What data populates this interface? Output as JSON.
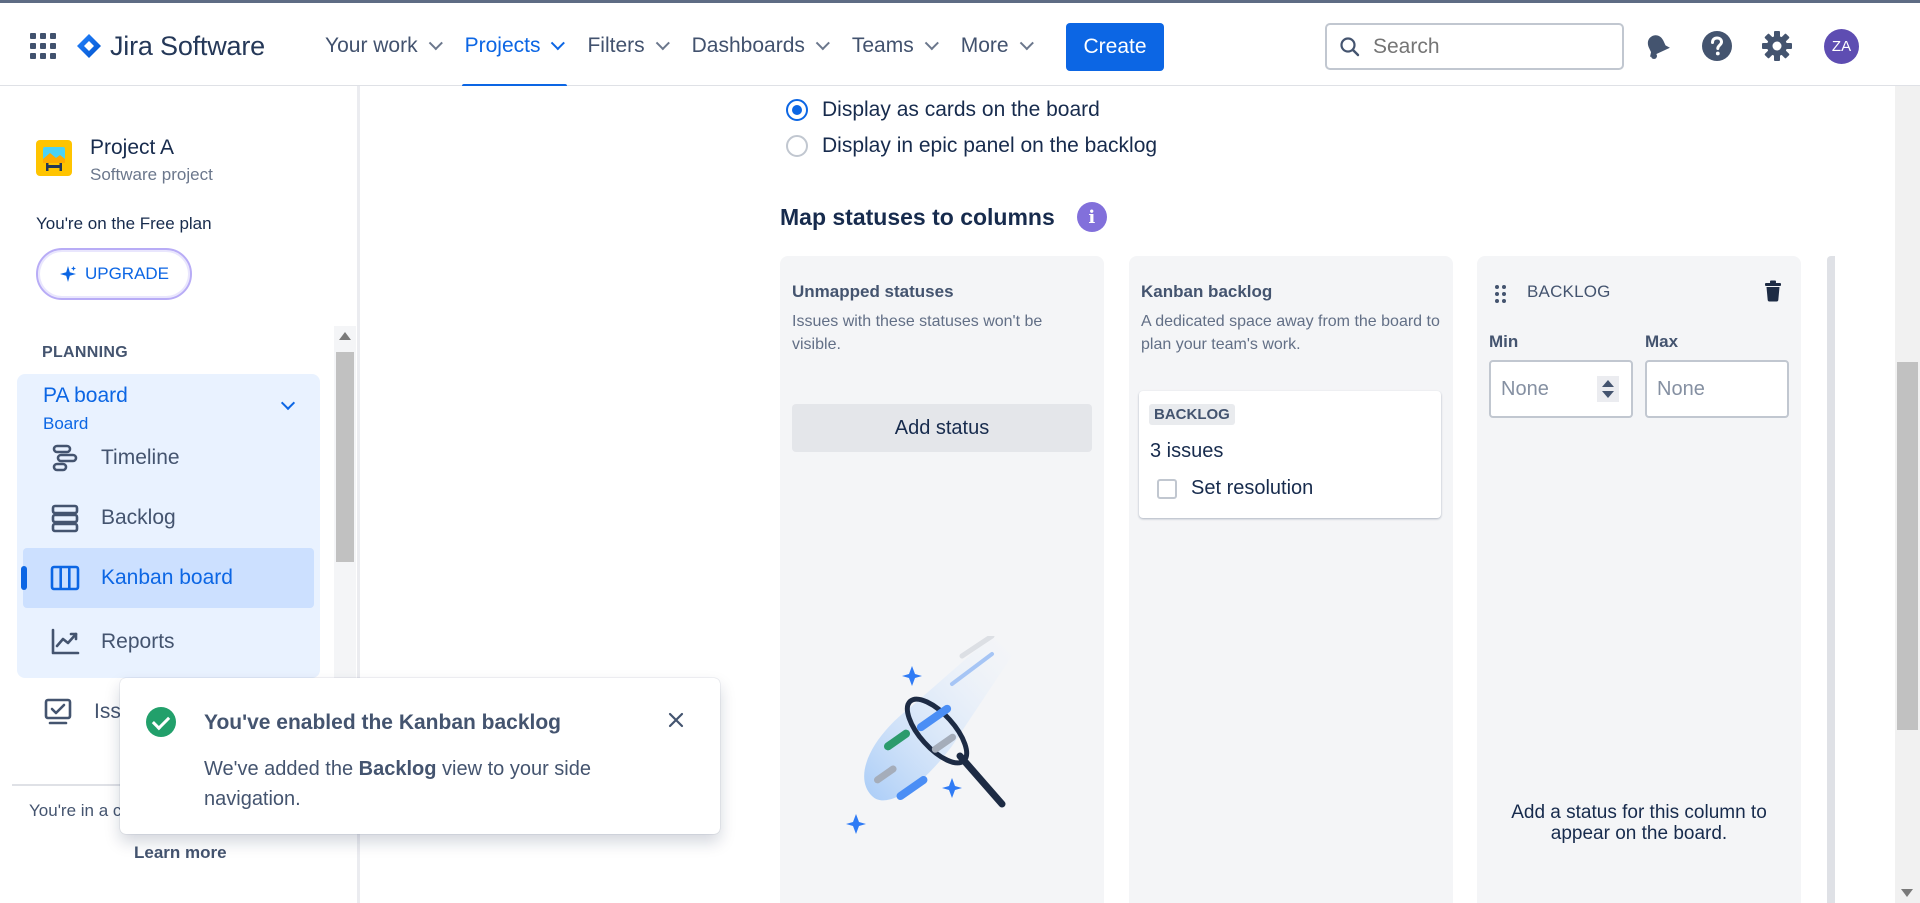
{
  "app": {
    "name": "Jira Software"
  },
  "nav": {
    "items": [
      {
        "label": "Your work"
      },
      {
        "label": "Projects"
      },
      {
        "label": "Filters"
      },
      {
        "label": "Dashboards"
      },
      {
        "label": "Teams"
      },
      {
        "label": "More"
      }
    ],
    "active": "Projects",
    "create_label": "Create",
    "search_placeholder": "Search",
    "avatar_initials": "ZA"
  },
  "sidebar": {
    "project_name": "Project A",
    "project_type": "Software project",
    "plan_text": "You're on the Free plan",
    "upgrade_label": "UPGRADE",
    "planning_label": "PLANNING",
    "board_name": "PA board",
    "board_type": "Board",
    "links": [
      {
        "label": "Timeline",
        "icon": "timeline-icon"
      },
      {
        "label": "Backlog",
        "icon": "backlog-icon"
      },
      {
        "label": "Kanban board",
        "icon": "kanban-board-icon",
        "selected": true
      },
      {
        "label": "Reports",
        "icon": "reports-icon"
      }
    ],
    "issues_label": "Iss",
    "team_text": "You're in a c",
    "learn_more": "Learn more"
  },
  "main": {
    "epic_options": [
      {
        "label": "Display as cards on the board",
        "checked": true
      },
      {
        "label": "Display in epic panel on the backlog",
        "checked": false
      }
    ],
    "section_title": "Map statuses to columns",
    "columns": {
      "unmapped": {
        "title": "Unmapped statuses",
        "description": "Issues with these statuses won't be visible.",
        "add_status_label": "Add status"
      },
      "kanban_backlog": {
        "title": "Kanban backlog",
        "description": "A dedicated space away from the board to plan your team's work.",
        "card": {
          "status": "BACKLOG",
          "issues": "3 issues",
          "set_resolution": "Set resolution"
        }
      },
      "backlog": {
        "title": "BACKLOG",
        "min_label": "Min",
        "max_label": "Max",
        "min_value": "None",
        "max_value": "None",
        "hint": "Add a status for this column to appear on the board."
      }
    }
  },
  "flag": {
    "title": "You've enabled the Kanban backlog",
    "body_prefix": "We've added the ",
    "body_bold": "Backlog",
    "body_suffix": " view to your side navigation."
  },
  "colors": {
    "primary": "#0c66e4",
    "success": "#22a06b",
    "info_purple": "#8270db",
    "selected_bg": "#cce0ff"
  }
}
